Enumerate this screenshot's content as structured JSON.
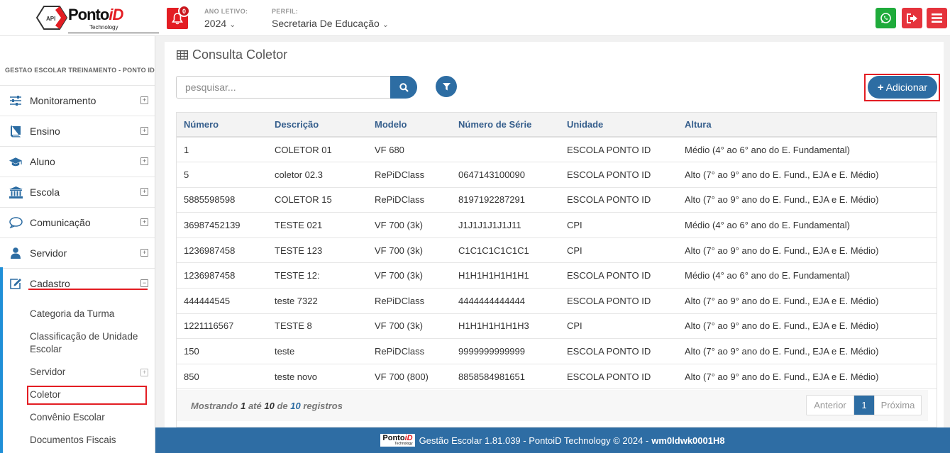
{
  "header": {
    "logo_text": "Ponto",
    "logo_text_id": "iD",
    "logo_sub": "Technology",
    "logo_hex_label": "API",
    "notifications_count": "0",
    "ano_letivo_label": "ANO LETIVO:",
    "ano_letivo_value": "2024",
    "perfil_label": "PERFIL:",
    "perfil_value": "Secretaria De Educação"
  },
  "sidebar": {
    "school_name": "GESTAO ESCOLAR TREINAMENTO - PONTO ID",
    "items": [
      {
        "label": "Monitoramento",
        "icon": "sliders-icon"
      },
      {
        "label": "Ensino",
        "icon": "book-icon"
      },
      {
        "label": "Aluno",
        "icon": "graduation-cap-icon"
      },
      {
        "label": "Escola",
        "icon": "institution-icon"
      },
      {
        "label": "Comunicação",
        "icon": "chat-icon"
      },
      {
        "label": "Servidor",
        "icon": "user-icon"
      },
      {
        "label": "Cadastro",
        "icon": "edit-icon"
      }
    ],
    "cadastro_sub": [
      "Categoria da Turma",
      "Classificação de Unidade",
      "Escolar",
      "Servidor",
      "Coletor",
      "Convênio Escolar",
      "Documentos Fiscais"
    ]
  },
  "main": {
    "title": "Consulta Coletor",
    "search_placeholder": "pesquisar...",
    "add_label": "Adicionar",
    "columns": [
      "Número",
      "Descrição",
      "Modelo",
      "Número de Série",
      "Unidade",
      "Altura"
    ],
    "rows": [
      [
        "1",
        "COLETOR 01",
        "VF 680",
        "",
        "ESCOLA PONTO ID",
        "Médio (4° ao 6° ano do E. Fundamental)"
      ],
      [
        "5",
        "coletor 02.3",
        "RePiDClass",
        "0647143100090",
        "ESCOLA PONTO ID",
        "Alto (7° ao 9° ano do E. Fund., EJA e E. Médio)"
      ],
      [
        "5885598598",
        "COLETOR 15",
        "RePiDClass",
        "8197192287291",
        "ESCOLA PONTO ID",
        "Alto (7° ao 9° ano do E. Fund., EJA e E. Médio)"
      ],
      [
        "36987452139",
        "TESTE 021",
        "VF 700 (3k)",
        "J1J1J1J1J1J11",
        "CPI",
        "Médio (4° ao 6° ano do E. Fundamental)"
      ],
      [
        "1236987458",
        "TESTE 123",
        "VF 700 (3k)",
        "C1C1C1C1C1C1",
        "CPI",
        "Alto (7° ao 9° ano do E. Fund., EJA e E. Médio)"
      ],
      [
        "1236987458",
        "TESTE 12:",
        "VF 700 (3k)",
        "H1H1H1H1H1H1",
        "ESCOLA PONTO ID",
        "Médio (4° ao 6° ano do E. Fundamental)"
      ],
      [
        "444444545",
        "teste 7322",
        "RePiDClass",
        "4444444444444",
        "ESCOLA PONTO ID",
        "Alto (7° ao 9° ano do E. Fund., EJA e E. Médio)"
      ],
      [
        "1221116567",
        "TESTE 8",
        "VF 700 (3k)",
        "H1H1H1H1H1H3",
        "CPI",
        "Alto (7° ao 9° ano do E. Fund., EJA e E. Médio)"
      ],
      [
        "150",
        "teste",
        "RePiDClass",
        "9999999999999",
        "ESCOLA PONTO ID",
        "Alto (7° ao 9° ano do E. Fund., EJA e E. Médio)"
      ],
      [
        "850",
        "teste novo",
        "VF 700 (800)",
        "8858584981651",
        "ESCOLA PONTO ID",
        "Alto (7° ao 9° ano do E. Fund., EJA e E. Médio)"
      ]
    ],
    "showing_prefix": "Mostrando",
    "showing_from": "1",
    "showing_mid": "até",
    "showing_to": "10",
    "showing_of": "de",
    "showing_total": "10",
    "showing_suffix": "registros",
    "pager_prev": "Anterior",
    "pager_current": "1",
    "pager_next": "Próxima"
  },
  "footer": {
    "logo_text": "Ponto",
    "logo_text_id": "iD",
    "logo_sub": "Technology",
    "text": "Gestão Escolar 1.81.039 - PontoiD Technology © 2024 -",
    "host": "wm0ldwk0001H8"
  },
  "colors": {
    "primary": "#2d6da3",
    "danger": "#e31d23",
    "whatsapp": "#1fab3b"
  }
}
